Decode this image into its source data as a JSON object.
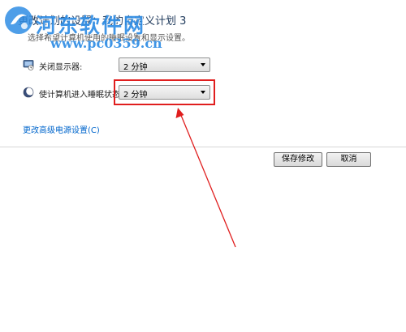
{
  "page": {
    "title": "更改计划的设置：我的自定义计划 3",
    "description": "选择希望计算机使用的睡眠设置和显示设置。"
  },
  "watermark": {
    "name": "河东软件网",
    "url": "www.pc0359.cn"
  },
  "settings": {
    "display_off": {
      "label": "关闭显示器:",
      "value": "2 分钟",
      "icon": "monitor-icon"
    },
    "sleep": {
      "label": "使计算机进入睡眠状态:",
      "value": "2 分钟",
      "icon": "moon-icon"
    }
  },
  "links": {
    "advanced": "更改高级电源设置(C)"
  },
  "buttons": {
    "save": "保存修改",
    "cancel": "取消"
  },
  "annotation": {
    "color": "#e01e1e"
  }
}
